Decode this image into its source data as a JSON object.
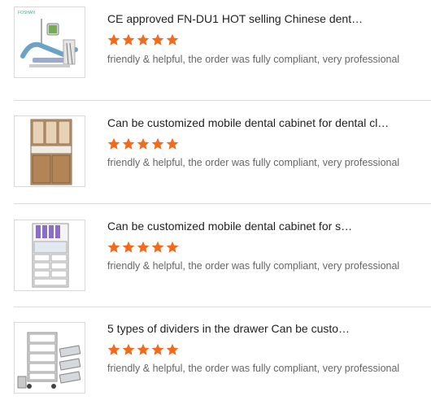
{
  "reviews": [
    {
      "title": "CE approved FN-DU1 HOT selling Chinese dent…",
      "rating": 5,
      "comment": "friendly & helpful, the order was fully compliant, very professional",
      "image_icon": "dental-chair-image",
      "brand_text": "FOSHAN"
    },
    {
      "title": "Can be customized mobile dental cabinet for dental cl…",
      "rating": 5,
      "comment": "friendly & helpful, the order was fully compliant, very professional",
      "image_icon": "wooden-dental-cabinet-image"
    },
    {
      "title": "Can be customized mobile dental cabinet for s…",
      "rating": 5,
      "comment": "friendly & helpful, the order was fully compliant, very professional",
      "image_icon": "white-dental-cabinet-image"
    },
    {
      "title": "5 types of dividers in the drawer Can be custo…",
      "rating": 5,
      "comment": "friendly & helpful, the order was fully compliant, very professional",
      "image_icon": "drawer-dividers-image"
    }
  ],
  "colors": {
    "star": "#f26b1d",
    "divider": "#dcdcdc"
  }
}
